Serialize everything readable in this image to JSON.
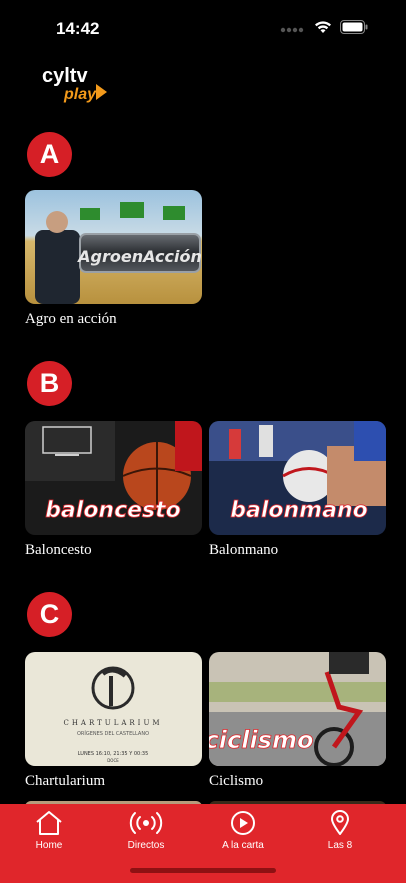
{
  "status_bar": {
    "time": "14:42"
  },
  "logo": {
    "line1": "cyltv",
    "line2": "play"
  },
  "sections": [
    {
      "letter": "A",
      "items": [
        {
          "title": "Agro en acción",
          "overlay": "AgroenAcción"
        }
      ]
    },
    {
      "letter": "B",
      "items": [
        {
          "title": "Baloncesto",
          "overlay": "baloncesto"
        },
        {
          "title": "Balonmano",
          "overlay": "balonmano"
        }
      ]
    },
    {
      "letter": "C",
      "items": [
        {
          "title": "Chartularium",
          "overlay": "CHARTULARIUM",
          "sub1": "ORÍGENES DEL CASTELLANO",
          "sub2": "LUNES 16:10, 21:35 Y 00:35",
          "sub3": "DOCE"
        },
        {
          "title": "Ciclismo",
          "overlay": "ciclismo"
        }
      ]
    }
  ],
  "tabbar": {
    "items": [
      {
        "label": "Home",
        "icon": "home-icon"
      },
      {
        "label": "Directos",
        "icon": "broadcast-icon"
      },
      {
        "label": "A la carta",
        "icon": "play-circle-icon"
      },
      {
        "label": "Las 8",
        "icon": "location-pin-icon"
      }
    ]
  },
  "colors": {
    "accent": "#e0262b",
    "badge": "#d61f26",
    "background": "#000000"
  }
}
